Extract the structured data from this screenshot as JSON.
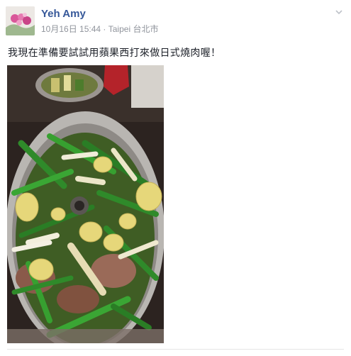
{
  "post": {
    "author": "Yeh Amy",
    "date": "10月16日 15:44",
    "separator": "·",
    "location": "Taipei 台北市",
    "message": "我現在準備要試試用蘋果西打來做日式燒肉喔！",
    "privacy_icon": "globe-icon",
    "menu_icon": "chevron-down-icon"
  }
}
